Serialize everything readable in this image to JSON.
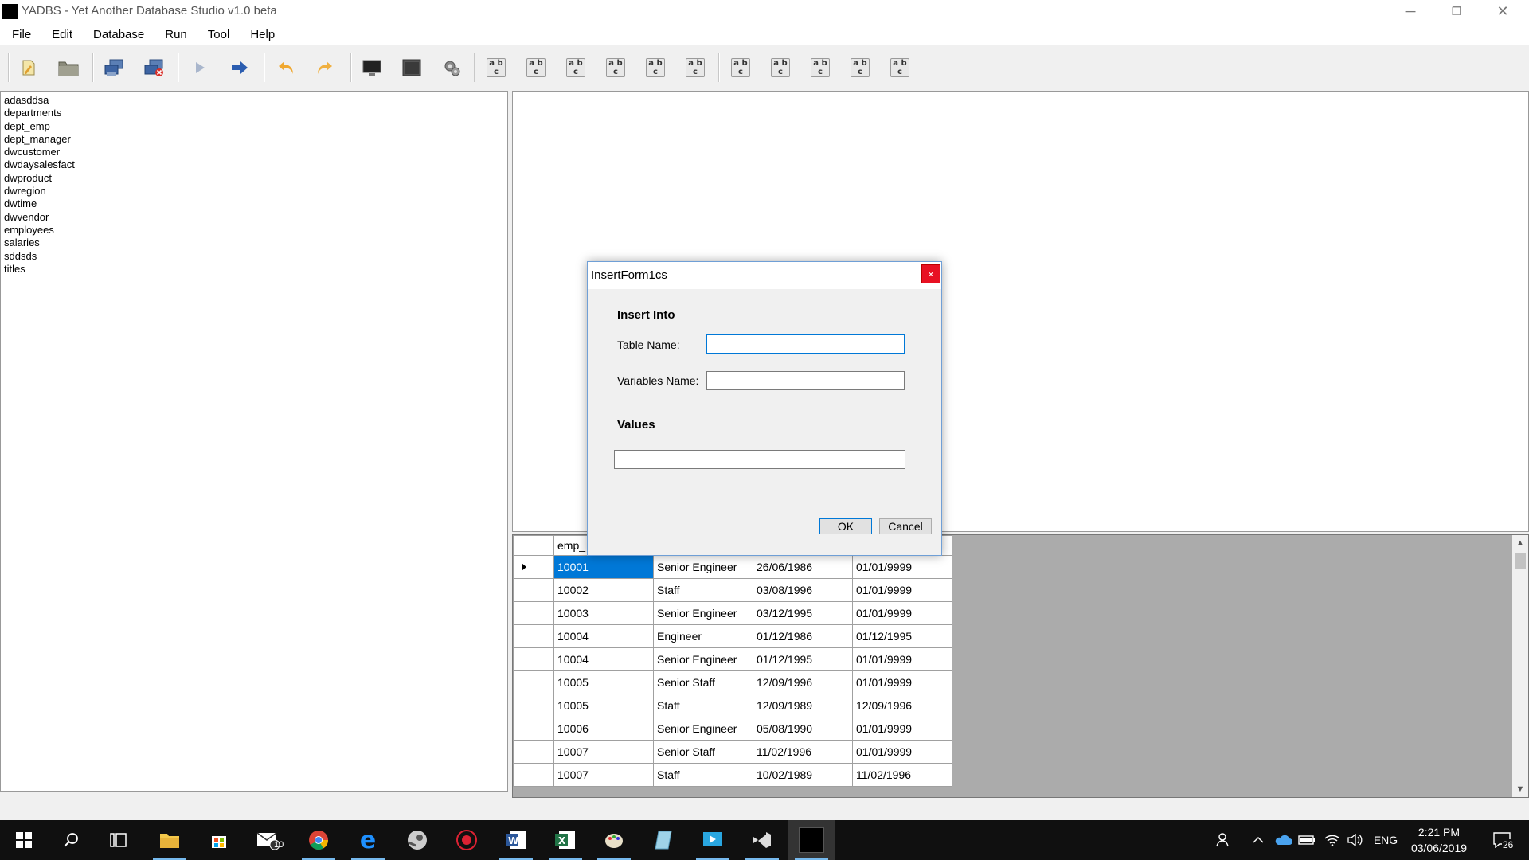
{
  "window": {
    "title": "YADBS - Yet Another Database Studio v1.0 beta",
    "minimize": "─",
    "restore": "❐",
    "close": "✕"
  },
  "menu": [
    "File",
    "Edit",
    "Database",
    "Run",
    "Tool",
    "Help"
  ],
  "toolbar": {
    "ab_glyph": "a b\nc"
  },
  "tables": [
    "adasddsa",
    "departments",
    "dept_emp",
    "dept_manager",
    "dwcustomer",
    "dwdaysalesfact",
    "dwproduct",
    "dwregion",
    "dwtime",
    "dwvendor",
    "employees",
    "salaries",
    "sddsds",
    "titles"
  ],
  "grid": {
    "header": "emp_",
    "rows": [
      [
        "10001",
        "Senior Engineer",
        "26/06/1986",
        "01/01/9999"
      ],
      [
        "10002",
        "Staff",
        "03/08/1996",
        "01/01/9999"
      ],
      [
        "10003",
        "Senior Engineer",
        "03/12/1995",
        "01/01/9999"
      ],
      [
        "10004",
        "Engineer",
        "01/12/1986",
        "01/12/1995"
      ],
      [
        "10004",
        "Senior Engineer",
        "01/12/1995",
        "01/01/9999"
      ],
      [
        "10005",
        "Senior Staff",
        "12/09/1996",
        "01/01/9999"
      ],
      [
        "10005",
        "Staff",
        "12/09/1989",
        "12/09/1996"
      ],
      [
        "10006",
        "Senior Engineer",
        "05/08/1990",
        "01/01/9999"
      ],
      [
        "10007",
        "Senior Staff",
        "11/02/1996",
        "01/01/9999"
      ],
      [
        "10007",
        "Staff",
        "10/02/1989",
        "11/02/1996"
      ]
    ]
  },
  "dialog": {
    "title": "InsertForm1cs",
    "close": "×",
    "insert_into": "Insert Into",
    "table_name_label": "Table Name:",
    "table_name_value": "",
    "variables_name_label": "Variables Name:",
    "variables_name_value": "",
    "values_heading": "Values",
    "values_value": "",
    "ok": "OK",
    "cancel": "Cancel"
  },
  "taskbar": {
    "mail_badge": "10",
    "language": "ENG",
    "time": "2:21 PM",
    "date": "03/06/2019",
    "notification_count": "26"
  },
  "colors": {
    "selection": "#0078d7",
    "dialog_close": "#e81123",
    "taskbar": "#101010"
  }
}
